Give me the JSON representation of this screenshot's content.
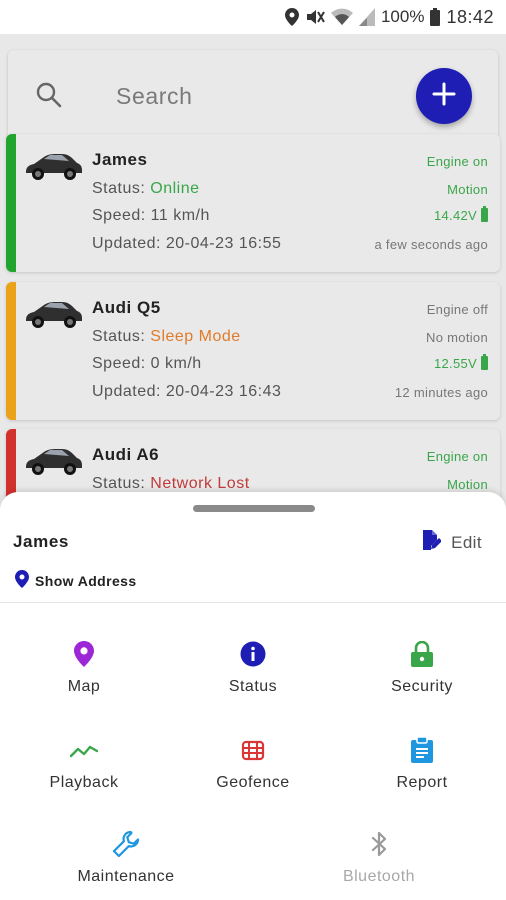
{
  "status_bar": {
    "battery_pct": "100%",
    "time": "18:42",
    "icons": [
      "location-icon",
      "mute-icon",
      "wifi-icon",
      "signal-icon",
      "battery-icon"
    ]
  },
  "search": {
    "placeholder": "Search",
    "add_icon": "plus-icon"
  },
  "vehicles": [
    {
      "name": "James",
      "status_label": "Status:",
      "status_value": "Online",
      "status_color": "#3aa64a",
      "speed": "Speed: 11 km/h",
      "updated": "Updated: 20-04-23 16:55",
      "engine": "Engine on",
      "motion": "Motion",
      "voltage": "14.42V",
      "ago": "a few seconds ago",
      "stripe_color": "#22a52e"
    },
    {
      "name": "Audi Q5",
      "status_label": "Status:",
      "status_value": "Sleep Mode",
      "status_color": "#e07b2a",
      "speed": "Speed: 0 km/h",
      "updated": "Updated: 20-04-23 16:43",
      "engine": "Engine off",
      "motion": "No motion",
      "voltage": "12.55V",
      "ago": "12 minutes ago",
      "stripe_color": "#e9a21a"
    },
    {
      "name": "Audi A6",
      "status_label": "Status:",
      "status_value": "Network Lost",
      "status_color": "#c23b3b",
      "engine": "Engine on",
      "motion": "Motion",
      "stripe_color": "#d2322d"
    }
  ],
  "sheet": {
    "title": "James",
    "edit_label": "Edit",
    "address_label": "Show Address",
    "actions": [
      {
        "label": "Map",
        "icon": "map-pin-icon",
        "color": "#9b27d6"
      },
      {
        "label": "Status",
        "icon": "info-icon",
        "color": "#1e1eb4"
      },
      {
        "label": "Security",
        "icon": "lock-icon",
        "color": "#3aa64a"
      },
      {
        "label": "Playback",
        "icon": "trend-line-icon",
        "color": "#3aa64a"
      },
      {
        "label": "Geofence",
        "icon": "fence-icon",
        "color": "#d93636"
      },
      {
        "label": "Report",
        "icon": "clipboard-icon",
        "color": "#1e97e0"
      },
      {
        "label": "Maintenance",
        "icon": "wrench-icon",
        "color": "#1e97e0"
      },
      {
        "label": "Bluetooth",
        "icon": "bluetooth-icon",
        "color": "#9a9a9a"
      }
    ]
  }
}
